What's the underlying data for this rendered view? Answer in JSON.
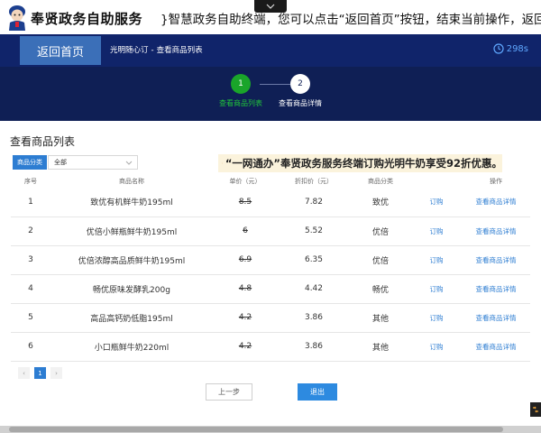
{
  "header": {
    "app_title": "奉贤政务自助服务",
    "marquee_text": "}智慧政务自助终端，您可以点击“返回首页”按钮，结束当前操作，返回开"
  },
  "nav": {
    "home_label": "返回首页",
    "breadcrumb": [
      "光明随心订",
      "查看商品列表"
    ],
    "breadcrumb_sep": "-",
    "timer": "298s"
  },
  "steps": [
    {
      "number": "1",
      "label": "查看商品列表"
    },
    {
      "number": "2",
      "label": "查看商品详情"
    }
  ],
  "page_title": "查看商品列表",
  "filter": {
    "tag": "商品分类",
    "selected": "全部"
  },
  "promo": "“一网通办”奉贤政务服务终端订购光明牛奶享受92折优惠。",
  "table": {
    "columns": [
      "序号",
      "商品名称",
      "单价（元）",
      "折扣价（元）",
      "商品分类",
      "",
      "操作"
    ],
    "rows": [
      {
        "idx": "1",
        "name": "致优有机鲜牛奶195ml",
        "orig": "8.5",
        "price": "7.82",
        "category": "致优",
        "order": "订购",
        "detail": "查看商品详情"
      },
      {
        "idx": "2",
        "name": "优倍小鲜瓶鲜牛奶195ml",
        "orig": "6",
        "price": "5.52",
        "category": "优倍",
        "order": "订购",
        "detail": "查看商品详情"
      },
      {
        "idx": "3",
        "name": "优倍浓醇高品质鲜牛奶195ml",
        "orig": "6.9",
        "price": "6.35",
        "category": "优倍",
        "order": "订购",
        "detail": "查看商品详情"
      },
      {
        "idx": "4",
        "name": "畅优原味发酵乳200g",
        "orig": "4.8",
        "price": "4.42",
        "category": "畅优",
        "order": "订购",
        "detail": "查看商品详情"
      },
      {
        "idx": "5",
        "name": "高品高钙奶低脂195ml",
        "orig": "4.2",
        "price": "3.86",
        "category": "其他",
        "order": "订购",
        "detail": "查看商品详情"
      },
      {
        "idx": "6",
        "name": "小口瓶鲜牛奶220ml",
        "orig": "4.2",
        "price": "3.86",
        "category": "其他",
        "order": "订购",
        "detail": "查看商品详情"
      }
    ]
  },
  "pagination": {
    "prev": "‹",
    "current": "1",
    "next": "›"
  },
  "buttons": {
    "prev": "上一步",
    "exit": "退出"
  },
  "colors": {
    "nav_band": "#10246a",
    "steps_band": "#0f1f55",
    "accent_blue": "#2d7dd2",
    "step_active": "#1aa52a",
    "price_red": "#d9263a",
    "promo_bg": "#fbf3dc"
  }
}
